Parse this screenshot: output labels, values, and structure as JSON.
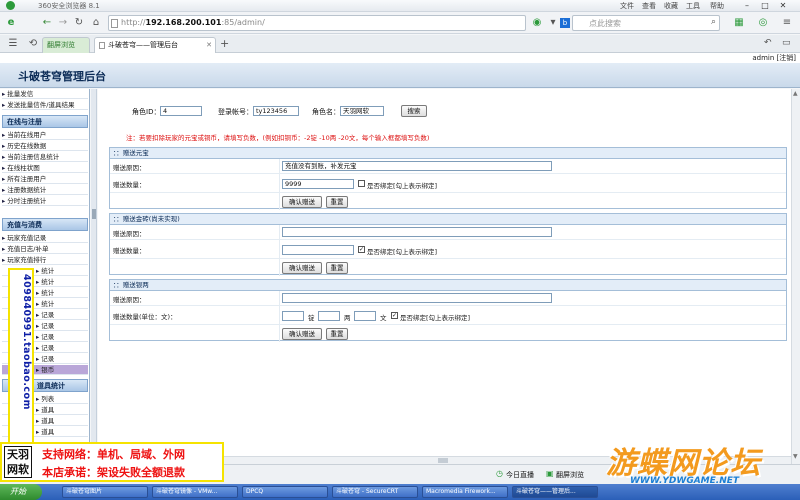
{
  "browser": {
    "app_title": "360安全浏览器 8.1",
    "menu": [
      "文件",
      "查看",
      "收藏",
      "工具",
      "帮助"
    ],
    "url_scheme": "http://",
    "url_host": "192.168.200.101",
    "url_path": ":85/admin/",
    "search_placeholder": "点此搜索",
    "tabs": [
      "翻屏浏览",
      "斗破苍穹——管理后台"
    ]
  },
  "user_info": "admin [注销]",
  "page_title": "斗破苍穹管理后台",
  "sidebar": {
    "top_items": [
      "批量发信",
      "发送批量信件/道具结果"
    ],
    "sections": [
      {
        "title": "在线与注册",
        "items": [
          "当前在线用户",
          "历史在线数据",
          "当前注册信息统计",
          "在线柱状图",
          "所有注册用户",
          "注册数据统计",
          "分时注册统计"
        ]
      },
      {
        "title": "充值与消费",
        "items": [
          "玩家充值记录",
          "充值日志/补单",
          "玩家充值排行",
          "统计",
          "统计",
          "统计",
          "统计",
          "记录",
          "记录",
          "记录",
          "记录",
          "记录",
          "银币"
        ]
      },
      {
        "title": "道具统计",
        "items": [
          "列表",
          "道具",
          "道具",
          "道具"
        ]
      }
    ]
  },
  "search": {
    "role_id_label": "角色ID：",
    "role_id_value": "4",
    "account_label": "登录帐号：",
    "account_value": "ty123456",
    "role_name_label": "角色名：",
    "role_name_value": "天羽网软",
    "search_button": "搜索"
  },
  "note": "注：若要扣除玩家的元宝或铜币，请填写负数，(例如扣铜币：-2锭 -10两 -20文，每个输入框都填写负数)",
  "panels": [
    {
      "title": "：：赠送元宝",
      "reason_label": "赠送原因：",
      "reason_value": "充值没有到账，补发元宝",
      "amount_label": "赠送数量：",
      "amount_value": "9999",
      "bind_label": "是否绑定[勾上表示绑定]",
      "bind_checked": false,
      "confirm": "确认赠送",
      "reset": "重置"
    },
    {
      "title": "：：赠送金砖(尚未实现)",
      "reason_label": "赠送原因：",
      "reason_value": "",
      "amount_label": "赠送数量：",
      "amount_value": "",
      "bind_label": "是否绑定[勾上表示绑定]",
      "bind_checked": true,
      "confirm": "确认赠送",
      "reset": "重置"
    },
    {
      "title": "：：赠送银两",
      "reason_label": "赠送原因：",
      "reason_value": "",
      "amount_label": "赠送数量(单位：文)：",
      "unit_ding": "锭",
      "unit_liang": "两",
      "unit_wen": "文",
      "bind_label": "是否绑定[勾上表示绑定]",
      "bind_checked": true,
      "confirm": "确认赠送",
      "reset": "重置"
    }
  ],
  "status_bar": {
    "today_live": "今日直播",
    "flip_browse": "翻屏浏览"
  },
  "taskbar": {
    "start": "开始",
    "tasks": [
      "斗破苍穹图片",
      "斗破苍穹镜像 - VMw...",
      "DPCQ",
      "斗破苍穹 - SecureCRT",
      "Macromedia Firework...",
      "斗破苍穹——管理后..."
    ]
  },
  "ads": {
    "vertical_text": "409840991.taobao.com",
    "logo_text": "天羽网软",
    "line1": "支持网络：单机、局域、外网",
    "line2": "本店承诺：架设失败全额退款"
  },
  "watermark": {
    "brand": "游蝶网论坛",
    "url": "WWW.YDWGAME.NET"
  }
}
